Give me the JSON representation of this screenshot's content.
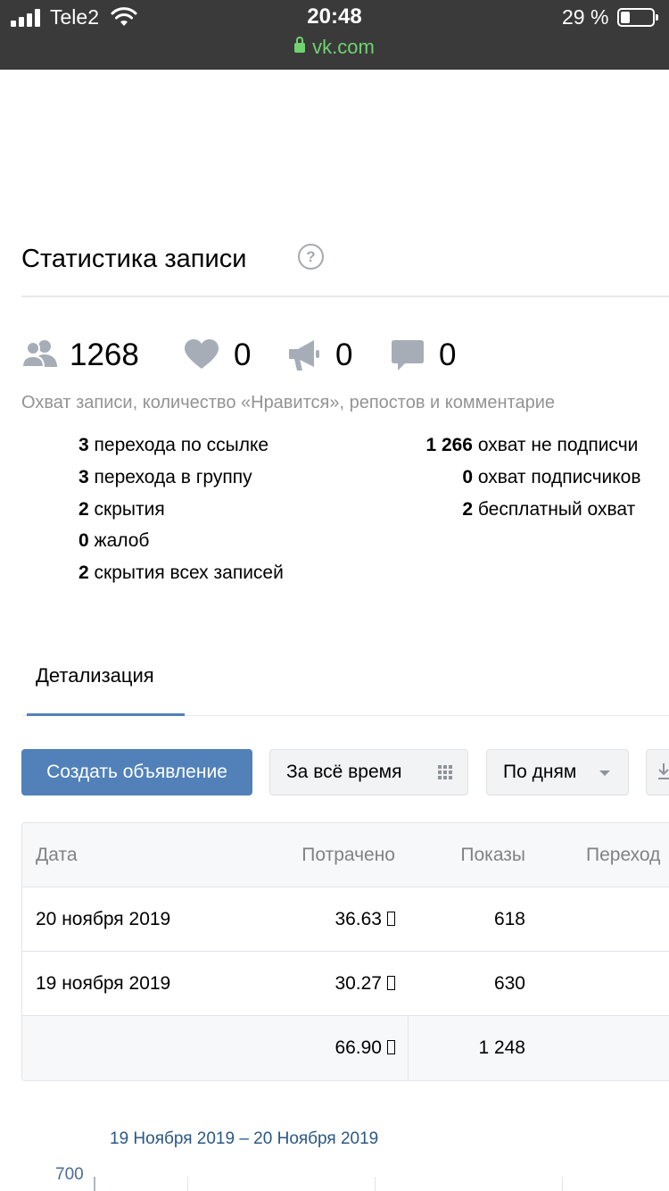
{
  "status_bar": {
    "carrier": "Tele2",
    "time": "20:48",
    "url": "vk.com",
    "battery": "29 %",
    "battery_level": 0.29
  },
  "header": {
    "title": "Статистика записи",
    "help": "?"
  },
  "counters": {
    "reach": "1268",
    "likes": "0",
    "reposts": "0",
    "comments": "0"
  },
  "subtitle": "Охват записи, количество «Нравится», репостов и комментарие",
  "stats_left": [
    {
      "value": "3",
      "label": "перехода по ссылке"
    },
    {
      "value": "3",
      "label": "перехода в группу"
    },
    {
      "value": "2",
      "label": "скрытия"
    },
    {
      "value": "0",
      "label": "жалоб"
    },
    {
      "value": "2",
      "label": "скрытия всех записей"
    }
  ],
  "stats_right": [
    {
      "value": "1 266",
      "label": "охват не подписчи"
    },
    {
      "value": "0",
      "label": "охват подписчиков"
    },
    {
      "value": "2",
      "label": "бесплатный охват"
    }
  ],
  "tabs": [
    {
      "label": "Детализация",
      "active": true
    }
  ],
  "toolbar": {
    "create_ad": "Создать объявление",
    "period": "За всё время",
    "grouping": "По дням"
  },
  "table": {
    "headers": [
      "Дата",
      "Потрачено",
      "Показы",
      "Переход"
    ],
    "rows": [
      {
        "date": "20 ноября 2019",
        "spent": "36.63",
        "shows": "618"
      },
      {
        "date": "19 ноября 2019",
        "spent": "30.27",
        "shows": "630"
      }
    ],
    "total": {
      "spent": "66.90",
      "shows": "1 248"
    }
  },
  "chart": {
    "range": "19 Ноября 2019 – 20 Ноября 2019",
    "y_top_label": "700"
  },
  "colors": {
    "accent": "#5181b8",
    "link": "#2a5885",
    "muted": "#939393",
    "url_green": "#6fd36f"
  }
}
